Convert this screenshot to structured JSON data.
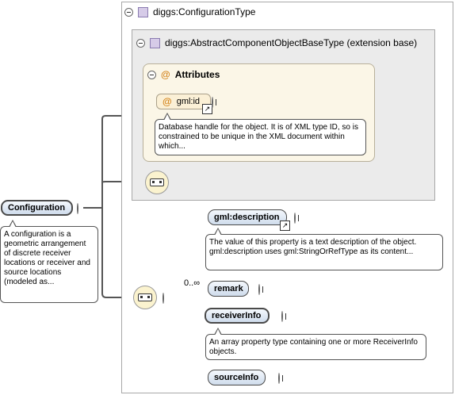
{
  "complex_type": {
    "label": "diggs:ConfigurationType"
  },
  "extension": {
    "label": "diggs:AbstractComponentObjectBaseType (extension base)"
  },
  "attributes": {
    "label": "Attributes",
    "symbol": "@",
    "items": [
      {
        "label": "gml:id",
        "doc": "Database handle for the object. It is of XML type ID, so is constrained to be unique in the XML document within which..."
      }
    ]
  },
  "root": {
    "label": "Configuration",
    "doc": "A configuration is a geometric arrangement of discrete receiver locations or receiver and source locations (modeled as..."
  },
  "elements": [
    {
      "label": "gml:description",
      "doc": "The value of this property is a text description of the object. gml:description uses gml:StringOrRefType as its content..."
    },
    {
      "label": "remark",
      "occurrence": "0..∞"
    },
    {
      "label": "receiverInfo",
      "doc": "An array property type containing one or more ReceiverInfo objects."
    },
    {
      "label": "sourceInfo"
    }
  ],
  "icons": [
    "collapse-icon",
    "expand-icon",
    "type-icon",
    "attribute-icon",
    "reference-arrow-icon",
    "sequence-compositor-icon"
  ],
  "colors": {
    "pill_top": "#f4f8fd",
    "pill_bottom": "#cfdcec",
    "attr_bg": "#fbf6e7",
    "ext_bg": "#ebebeb",
    "sequence_bg": "#fbf3cf",
    "attr_symbol": "#d4861f"
  }
}
